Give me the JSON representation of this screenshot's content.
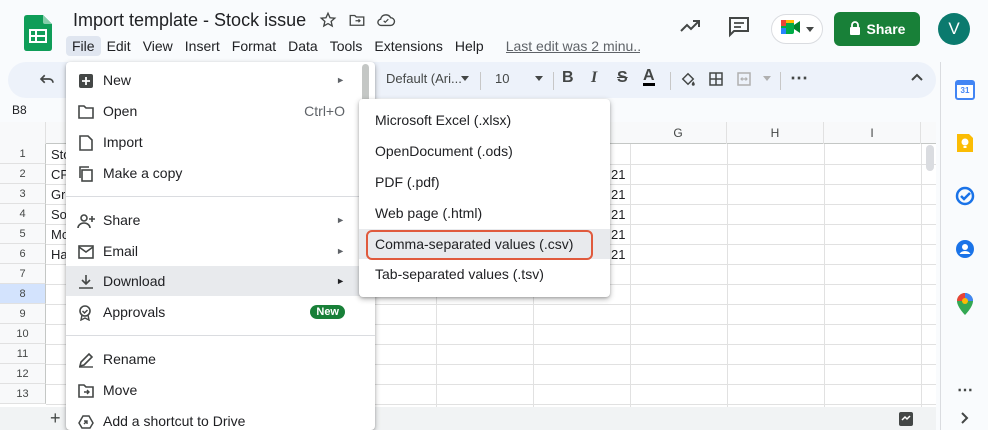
{
  "header": {
    "title": "Import template - Stock issue",
    "last_edit": "Last edit was 2 minu...",
    "share_label": "Share",
    "avatar_letter": "V"
  },
  "menubar": [
    "File",
    "Edit",
    "View",
    "Insert",
    "Format",
    "Data",
    "Tools",
    "Extensions",
    "Help"
  ],
  "toolbar": {
    "font": "Default (Ari...",
    "font_size": "10",
    "bold": "B",
    "italic": "I",
    "strike": "S",
    "text_color": "A"
  },
  "namebox": "B8",
  "grid": {
    "columns": [
      "G",
      "H",
      "I"
    ],
    "rows": [
      "1",
      "2",
      "3",
      "4",
      "5",
      "6",
      "7",
      "8",
      "9",
      "10",
      "11",
      "12",
      "13"
    ],
    "col_b_visible": [
      "Sto",
      "CP",
      "Gr",
      "So",
      "Mo",
      "Ha"
    ],
    "col_f_visible": [
      "21",
      "21",
      "21",
      "21",
      "21"
    ]
  },
  "file_menu": {
    "items": [
      {
        "label": "New",
        "has_submenu": true
      },
      {
        "label": "Open",
        "shortcut": "Ctrl+O"
      },
      {
        "label": "Import"
      },
      {
        "label": "Make a copy"
      },
      {
        "label": "Share",
        "has_submenu": true
      },
      {
        "label": "Email",
        "has_submenu": true
      },
      {
        "label": "Download",
        "has_submenu": true
      },
      {
        "label": "Approvals",
        "badge": "New"
      },
      {
        "label": "Rename"
      },
      {
        "label": "Move"
      },
      {
        "label": "Add a shortcut to Drive"
      }
    ]
  },
  "download_menu": {
    "items": [
      "Microsoft Excel (.xlsx)",
      "OpenDocument (.ods)",
      "PDF (.pdf)",
      "Web page (.html)",
      "Comma-separated values (.csv)",
      "Tab-separated values (.tsv)"
    ]
  },
  "side_panel": {
    "calendar_day": "31"
  },
  "colors": {
    "share_green": "#188038",
    "avatar_teal": "#0b7a6e",
    "highlight_red": "#e05a3d",
    "menu_hover": "#e8eaed"
  }
}
